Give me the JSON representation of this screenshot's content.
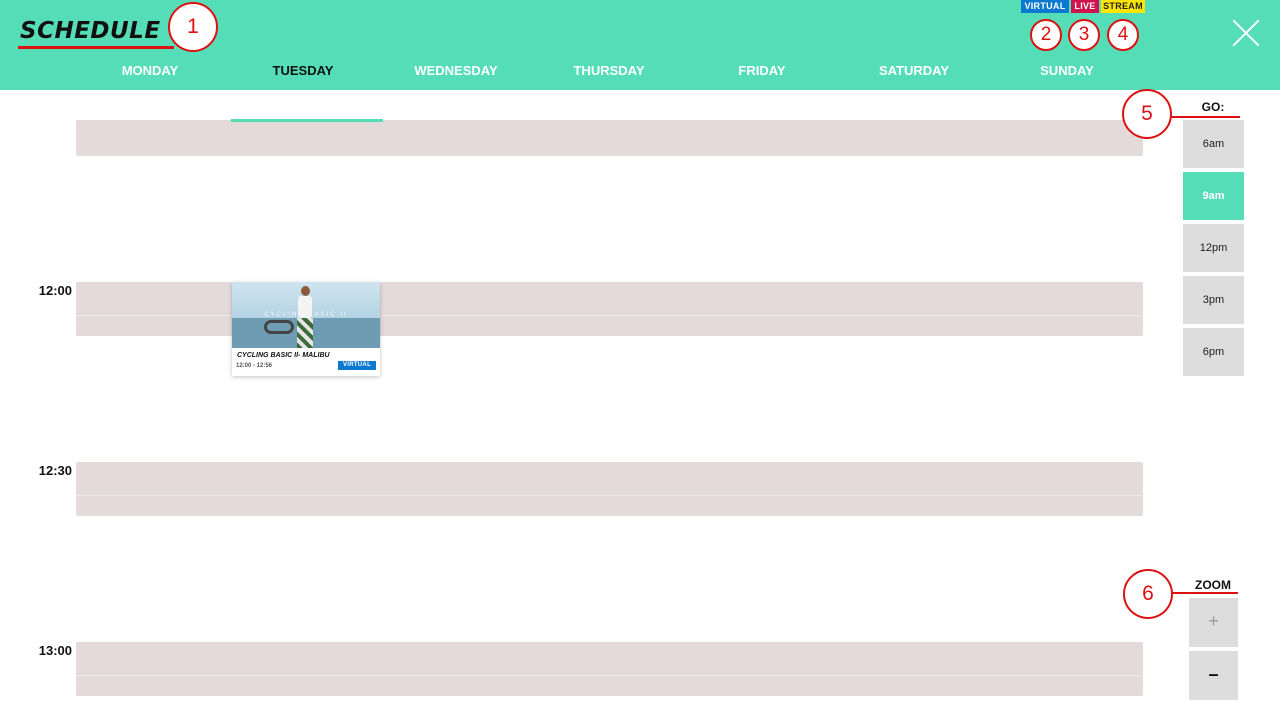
{
  "header": {
    "title": "SCHEDULE",
    "legend": {
      "virtual": "VIRTUAL",
      "live": "LIVE",
      "stream": "STREAM"
    },
    "days": [
      "MONDAY",
      "TUESDAY",
      "WEDNESDAY",
      "THURSDAY",
      "FRIDAY",
      "SATURDAY",
      "SUNDAY"
    ],
    "active_day": "TUESDAY",
    "close_icon": "close-icon"
  },
  "callouts": [
    "1",
    "2",
    "3",
    "4",
    "5",
    "6"
  ],
  "schedule": {
    "times": [
      "12:00",
      "12:30",
      "13:00"
    ],
    "class_card": {
      "title": "CYCLING BASIC II- MALIBU",
      "time": "12:00 - 12:56",
      "badge": "VIRTUAL",
      "image_text": "CYCLING BASIC II"
    }
  },
  "go": {
    "label": "GO:",
    "options": [
      "6am",
      "9am",
      "12pm",
      "3pm",
      "6pm"
    ],
    "active": "9am"
  },
  "zoom": {
    "label": "ZOOM",
    "in": "+",
    "out": "–"
  },
  "colors": {
    "header_bg": "#54ddb6",
    "virtual": "#0b79d0",
    "live": "#d0124e",
    "stream": "#ffe600",
    "band": "#e4dada",
    "callout": "#dd1111"
  }
}
